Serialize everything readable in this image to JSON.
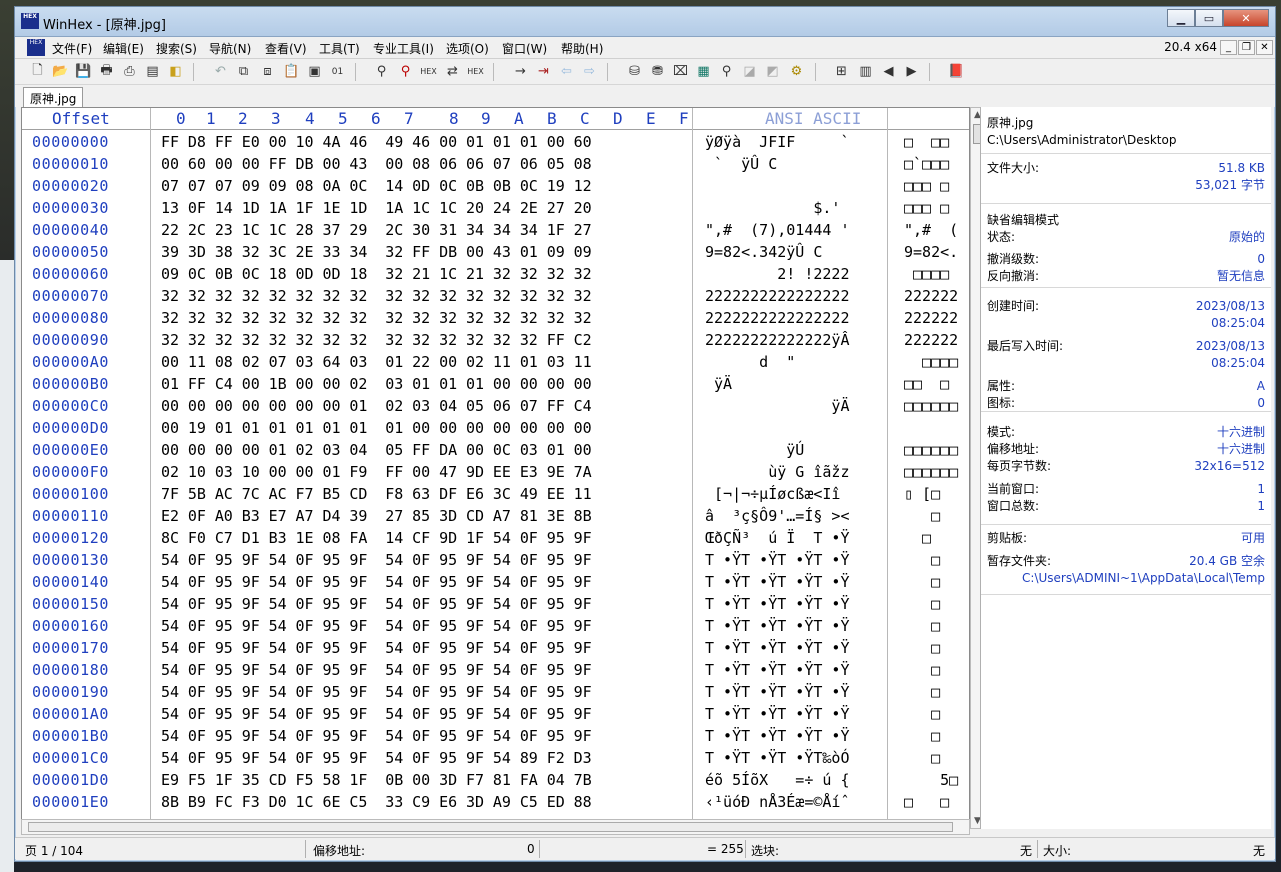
{
  "window": {
    "title": "WinHex - [原神.jpg]",
    "app_icon": "HEX"
  },
  "menu": {
    "items": [
      "文件(F)",
      "编辑(E)",
      "搜索(S)",
      "导航(N)",
      "查看(V)",
      "工具(T)",
      "专业工具(I)",
      "选项(O)",
      "窗口(W)",
      "帮助(H)"
    ],
    "zoom": "20.4 x64"
  },
  "toolbar": {
    "icons": [
      "new-file-icon",
      "open-file-icon",
      "save-icon",
      "print-icon",
      "properties-icon",
      "open-folder-icon",
      "undo-icon",
      "copy-icon",
      "cut-icon",
      "paste-icon",
      "copy-block-icon",
      "binary-icon",
      "find-icon",
      "find-hex-icon",
      "replace-icon",
      "replace-hex-icon",
      "find-next-icon",
      "goto-offset-icon",
      "jump-icon",
      "back-icon",
      "forward-icon",
      "disk-icon",
      "ram-icon",
      "disk-tool-icon",
      "calculator-icon",
      "hash-icon",
      "compare-icon",
      "tools-icon",
      "settings-icon",
      "config-icon",
      "pages-icon",
      "previous-icon",
      "next-icon",
      "help-book-icon"
    ]
  },
  "tab": {
    "label": "原神.jpg"
  },
  "header": {
    "offset": "Offset",
    "cols": [
      "0",
      "1",
      "2",
      "3",
      "4",
      "5",
      "6",
      "7",
      "8",
      "9",
      "A",
      "B",
      "C",
      "D",
      "E",
      "F"
    ],
    "ansi": "ANSI ASCII"
  },
  "rows": [
    {
      "off": "00000000",
      "hex": "FF D8 FF E0 00 10 4A 46  49 46 00 01 01 01 00 60",
      "ansi": "ÿØÿà  JFIF     `",
      "ascii": "□  □□"
    },
    {
      "off": "00000010",
      "hex": "00 60 00 00 FF DB 00 43  00 08 06 06 07 06 05 08",
      "ansi": " `  ÿÛ C        ",
      "ascii": "□`□□□"
    },
    {
      "off": "00000020",
      "hex": "07 07 07 09 09 08 0A 0C  14 0D 0C 0B 0B 0C 19 12",
      "ansi": "                ",
      "ascii": "□□□ □"
    },
    {
      "off": "00000030",
      "hex": "13 0F 14 1D 1A 1F 1E 1D  1A 1C 1C 20 24 2E 27 20",
      "ansi": "            $.' ",
      "ascii": "□□□ □"
    },
    {
      "off": "00000040",
      "hex": "22 2C 23 1C 1C 28 37 29  2C 30 31 34 34 34 1F 27",
      "ansi": "\",#  (7),01444 '",
      "ascii": "\",#  ("
    },
    {
      "off": "00000050",
      "hex": "39 3D 38 32 3C 2E 33 34  32 FF DB 00 43 01 09 09",
      "ansi": "9=82<.342ÿÛ C   ",
      "ascii": "9=82<."
    },
    {
      "off": "00000060",
      "hex": "09 0C 0B 0C 18 0D 0D 18  32 21 1C 21 32 32 32 32",
      "ansi": "        2! !2222",
      "ascii": " □□□□"
    },
    {
      "off": "00000070",
      "hex": "32 32 32 32 32 32 32 32  32 32 32 32 32 32 32 32",
      "ansi": "2222222222222222",
      "ascii": "222222"
    },
    {
      "off": "00000080",
      "hex": "32 32 32 32 32 32 32 32  32 32 32 32 32 32 32 32",
      "ansi": "2222222222222222",
      "ascii": "222222"
    },
    {
      "off": "00000090",
      "hex": "32 32 32 32 32 32 32 32  32 32 32 32 32 32 FF C2",
      "ansi": "22222222222222ÿÂ",
      "ascii": "222222"
    },
    {
      "off": "000000A0",
      "hex": "00 11 08 02 07 03 64 03  01 22 00 02 11 01 03 11",
      "ansi": "      d  \"      ",
      "ascii": "  □□□□"
    },
    {
      "off": "000000B0",
      "hex": "01 FF C4 00 1B 00 00 02  03 01 01 01 00 00 00 00",
      "ansi": " ÿÄ             ",
      "ascii": "□□  □"
    },
    {
      "off": "000000C0",
      "hex": "00 00 00 00 00 00 00 01  02 03 04 05 06 07 FF C4",
      "ansi": "              ÿÄ",
      "ascii": "□□□□□□"
    },
    {
      "off": "000000D0",
      "hex": "00 19 01 01 01 01 01 01  01 00 00 00 00 00 00 00",
      "ansi": "                ",
      "ascii": ""
    },
    {
      "off": "000000E0",
      "hex": "00 00 00 00 01 02 03 04  05 FF DA 00 0C 03 01 00",
      "ansi": "         ÿÚ     ",
      "ascii": "□□□□□□"
    },
    {
      "off": "000000F0",
      "hex": "02 10 03 10 00 00 01 F9  FF 00 47 9D EE E3 9E 7A",
      "ansi": "       ùÿ G îãžz",
      "ascii": "□□□□□□"
    },
    {
      "off": "00000100",
      "hex": "7F 5B AC 7C AC F7 B5 CD  F8 63 DF E6 3C 49 EE 11",
      "ansi": " [¬|¬÷µÍøcßæ<Iî ",
      "ascii": "▯ [□"
    },
    {
      "off": "00000110",
      "hex": "E2 0F A0 B3 E7 A7 D4 39  27 85 3D CD A7 81 3E 8B",
      "ansi": "â  ³ç§Ô9'…=Í§ ><",
      "ascii": "   □"
    },
    {
      "off": "00000120",
      "hex": "8C F0 C7 D1 B3 1E 08 FA  14 CF 9D 1F 54 0F 95 9F",
      "ansi": "ŒðÇÑ³  ú Ï  T •Ÿ",
      "ascii": "  □"
    },
    {
      "off": "00000130",
      "hex": "54 0F 95 9F 54 0F 95 9F  54 0F 95 9F 54 0F 95 9F",
      "ansi": "T •ŸT •ŸT •ŸT •Ÿ",
      "ascii": "   □"
    },
    {
      "off": "00000140",
      "hex": "54 0F 95 9F 54 0F 95 9F  54 0F 95 9F 54 0F 95 9F",
      "ansi": "T •ŸT •ŸT •ŸT •Ÿ",
      "ascii": "   □"
    },
    {
      "off": "00000150",
      "hex": "54 0F 95 9F 54 0F 95 9F  54 0F 95 9F 54 0F 95 9F",
      "ansi": "T •ŸT •ŸT •ŸT •Ÿ",
      "ascii": "   □"
    },
    {
      "off": "00000160",
      "hex": "54 0F 95 9F 54 0F 95 9F  54 0F 95 9F 54 0F 95 9F",
      "ansi": "T •ŸT •ŸT •ŸT •Ÿ",
      "ascii": "   □"
    },
    {
      "off": "00000170",
      "hex": "54 0F 95 9F 54 0F 95 9F  54 0F 95 9F 54 0F 95 9F",
      "ansi": "T •ŸT •ŸT •ŸT •Ÿ",
      "ascii": "   □"
    },
    {
      "off": "00000180",
      "hex": "54 0F 95 9F 54 0F 95 9F  54 0F 95 9F 54 0F 95 9F",
      "ansi": "T •ŸT •ŸT •ŸT •Ÿ",
      "ascii": "   □"
    },
    {
      "off": "00000190",
      "hex": "54 0F 95 9F 54 0F 95 9F  54 0F 95 9F 54 0F 95 9F",
      "ansi": "T •ŸT •ŸT •ŸT •Ÿ",
      "ascii": "   □"
    },
    {
      "off": "000001A0",
      "hex": "54 0F 95 9F 54 0F 95 9F  54 0F 95 9F 54 0F 95 9F",
      "ansi": "T •ŸT •ŸT •ŸT •Ÿ",
      "ascii": "   □"
    },
    {
      "off": "000001B0",
      "hex": "54 0F 95 9F 54 0F 95 9F  54 0F 95 9F 54 0F 95 9F",
      "ansi": "T •ŸT •ŸT •ŸT •Ÿ",
      "ascii": "   □"
    },
    {
      "off": "000001C0",
      "hex": "54 0F 95 9F 54 0F 95 9F  54 0F 95 9F 54 89 F2 D3",
      "ansi": "T •ŸT •ŸT •ŸT‰òÓ",
      "ascii": "   □"
    },
    {
      "off": "000001D0",
      "hex": "E9 F5 1F 35 CD F5 58 1F  0B 00 3D F7 81 FA 04 7B",
      "ansi": "éõ 5ÍõX   =÷ ú {",
      "ascii": "    5□"
    },
    {
      "off": "000001E0",
      "hex": "8B B9 FC F3 D0 1C 6E C5  33 C9 E6 3D A9 C5 ED 88",
      "ansi": "‹¹üóÐ nÅ3Éæ=©Åíˆ",
      "ascii": "□   □"
    }
  ],
  "side": {
    "file_name": "原神.jpg",
    "file_path": "C:\\Users\\Administrator\\Desktop",
    "size_label": "文件大小:",
    "size_kb": "51.8 KB",
    "size_bytes": "53,021 字节",
    "edit_mode_title": "缺省编辑模式",
    "state_label": "状态:",
    "state_value": "原始的",
    "undo_label": "撤消级数:",
    "undo_value": "0",
    "redo_label": "反向撤消:",
    "redo_value": "暂无信息",
    "created_label": "创建时间:",
    "created_date": "2023/08/13",
    "created_time": "08:25:04",
    "modified_label": "最后写入时间:",
    "modified_date": "2023/08/13",
    "modified_time": "08:25:04",
    "attr_label": "属性:",
    "attr_value": "A",
    "icon_label": "图标:",
    "icon_value": "0",
    "mode_label": "模式:",
    "mode_value": "十六进制",
    "offset_label": "偏移地址:",
    "offset_value": "十六进制",
    "bpp_label": "每页字节数:",
    "bpp_value": "32x16=512",
    "curwin_label": "当前窗口:",
    "curwin_value": "1",
    "totalwin_label": "窗口总数:",
    "totalwin_value": "1",
    "clip_label": "剪贴板:",
    "clip_value": "可用",
    "temp_label": "暂存文件夹:",
    "temp_value": "20.4 GB 空余",
    "temp_path": "C:\\Users\\ADMINI~1\\AppData\\Local\\Temp"
  },
  "status": {
    "page": "页 1 / 104",
    "offset_label": "偏移地址:",
    "offset_value": "0",
    "value": "= 255",
    "block_label": "选块:",
    "block_value": "无",
    "size_label": "大小:",
    "size_value": "无"
  }
}
